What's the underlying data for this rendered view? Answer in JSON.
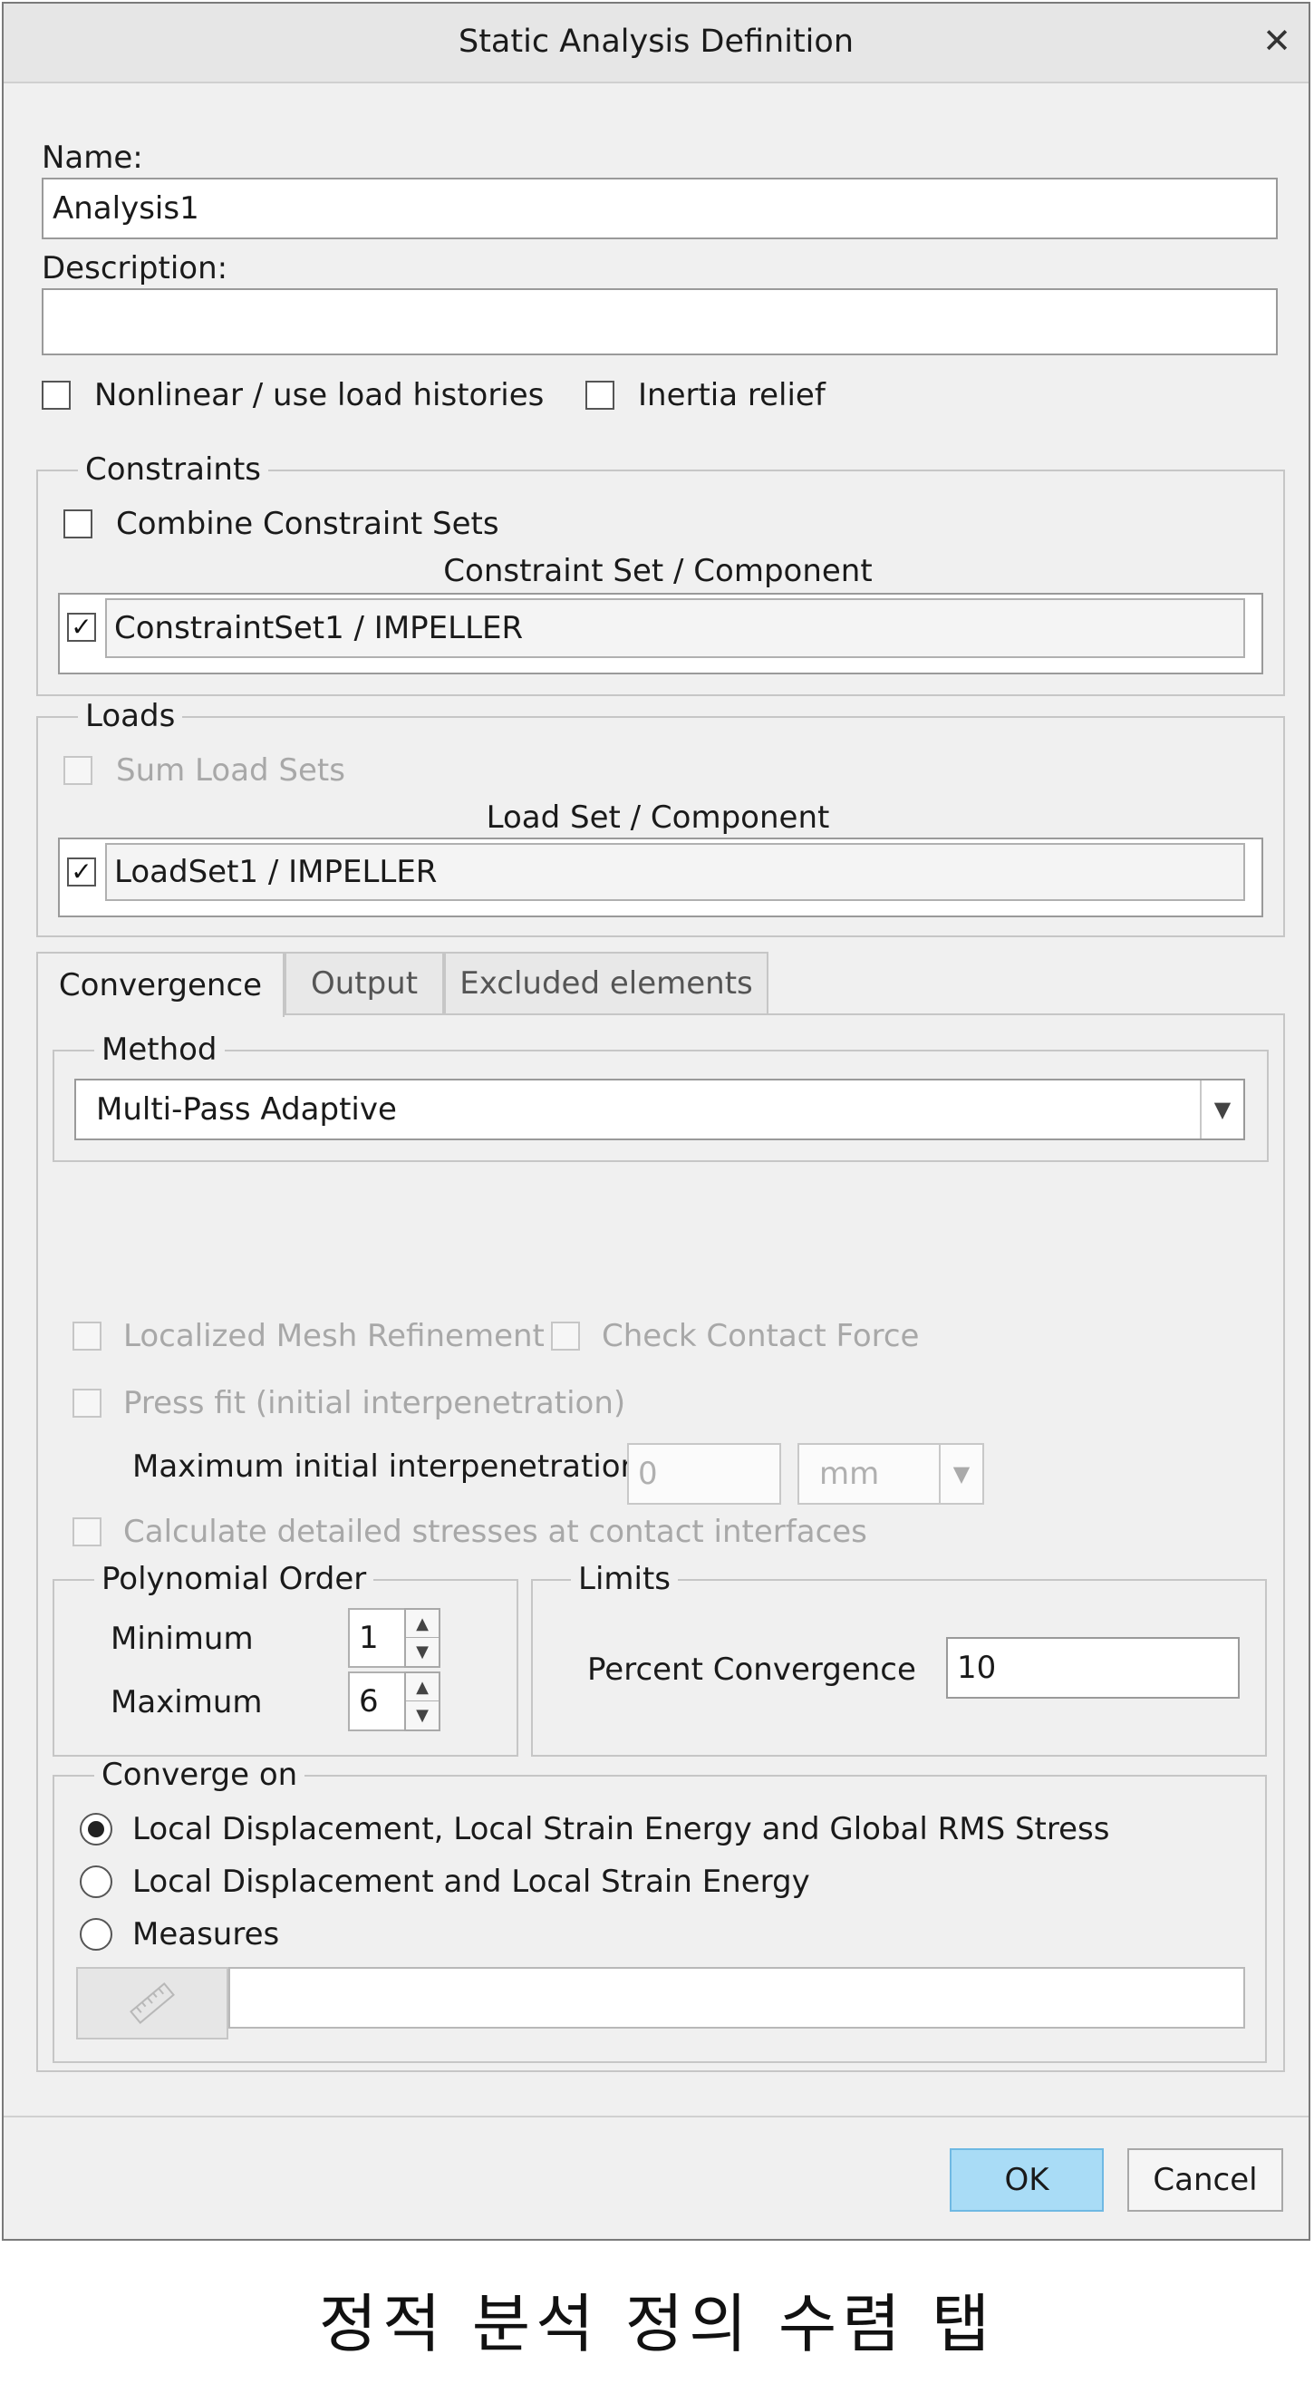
{
  "dialog": {
    "title": "Static Analysis Definition",
    "close_icon": "close-icon"
  },
  "name": {
    "label": "Name:",
    "value": "Analysis1"
  },
  "description": {
    "label": "Description:",
    "value": ""
  },
  "options": {
    "nonlinear": {
      "label": "Nonlinear / use load histories",
      "checked": false
    },
    "inertia": {
      "label": "Inertia relief",
      "checked": false
    }
  },
  "constraints": {
    "title": "Constraints",
    "combine_label": "Combine Constraint Sets",
    "column_header": "Constraint Set / Component",
    "rows": [
      {
        "label": "ConstraintSet1 / IMPELLER",
        "checked": true
      }
    ]
  },
  "loads": {
    "title": "Loads",
    "sum_label": "Sum Load Sets",
    "column_header": "Load Set / Component",
    "rows": [
      {
        "label": "LoadSet1 / IMPELLER",
        "checked": true
      }
    ]
  },
  "tabs": [
    {
      "label": "Convergence",
      "active": true
    },
    {
      "label": "Output",
      "active": false
    },
    {
      "label": "Excluded elements",
      "active": false
    }
  ],
  "convergence": {
    "method": {
      "title": "Method",
      "selected": "Multi-Pass Adaptive"
    },
    "localized_mesh": "Localized Mesh Refinement",
    "check_contact": "Check Contact Force",
    "press_fit": "Press fit (initial interpenetration)",
    "max_interpenetration": {
      "label": "Maximum initial interpenetration",
      "value": "0",
      "unit": "mm"
    },
    "calc_stresses": "Calculate detailed stresses at contact interfaces",
    "polynomial_order": {
      "title": "Polynomial Order",
      "min_label": "Minimum",
      "min_value": "1",
      "max_label": "Maximum",
      "max_value": "6"
    },
    "limits": {
      "title": "Limits",
      "percent_label": "Percent Convergence",
      "percent_value": "10"
    },
    "converge_on": {
      "title": "Converge on",
      "options": [
        {
          "label": "Local Displacement, Local Strain Energy and Global RMS Stress",
          "selected": true
        },
        {
          "label": "Local Displacement and Local Strain Energy",
          "selected": false
        },
        {
          "label": "Measures",
          "selected": false
        }
      ],
      "measure_icon": "ruler-icon",
      "measure_value": ""
    }
  },
  "buttons": {
    "ok": "OK",
    "cancel": "Cancel"
  },
  "caption": "정적 분석 정의 수렴 탭"
}
